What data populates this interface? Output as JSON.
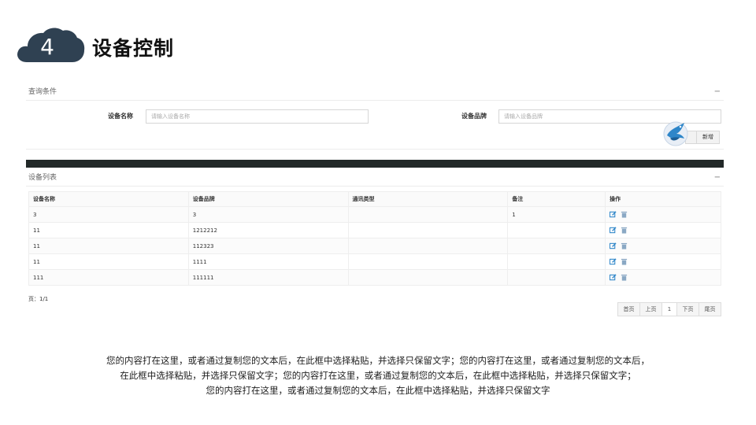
{
  "slide": {
    "number": "4",
    "title": "设备控制"
  },
  "query_panel": {
    "title": "查询条件",
    "collapse": "−",
    "device_name": {
      "label": "设备名称",
      "placeholder": "请输入设备名称",
      "value": ""
    },
    "device_brand": {
      "label": "设备品牌",
      "placeholder": "请输入设备品牌",
      "value": ""
    },
    "add_button": "新增"
  },
  "list_panel": {
    "title": "设备列表",
    "collapse": "−",
    "columns": [
      "设备名称",
      "设备品牌",
      "通讯类型",
      "备注",
      "操作"
    ],
    "rows": [
      {
        "name": "3",
        "brand": "3",
        "comm": "",
        "note": "1"
      },
      {
        "name": "11",
        "brand": "1212212",
        "comm": "",
        "note": ""
      },
      {
        "name": "11",
        "brand": "112323",
        "comm": "",
        "note": ""
      },
      {
        "name": "11",
        "brand": "1111",
        "comm": "",
        "note": ""
      },
      {
        "name": "111",
        "brand": "111111",
        "comm": "",
        "note": ""
      }
    ],
    "row_actions": [
      "edit-icon",
      "delete-icon"
    ],
    "page_info": "页：1/1",
    "pager": [
      "首页",
      "上页",
      "1",
      "下页",
      "尾页"
    ]
  },
  "description": [
    "您的内容打在这里，或者通过复制您的文本后，在此框中选择粘贴，并选择只保留文字；您的内容打在这里，或者通过复制您的文本后，",
    "在此框中选择粘贴，并选择只保留文字；您的内容打在这里，或者通过复制您的文本后，在此框中选择粘贴，并选择只保留文字；",
    "您的内容打在这里，或者通过复制您的文本后，在此框中选择粘贴，并选择只保留文字"
  ],
  "colors": {
    "cloud": "#2f4152",
    "dark_bar": "#222928",
    "icon_blue": "#2e86c9"
  }
}
